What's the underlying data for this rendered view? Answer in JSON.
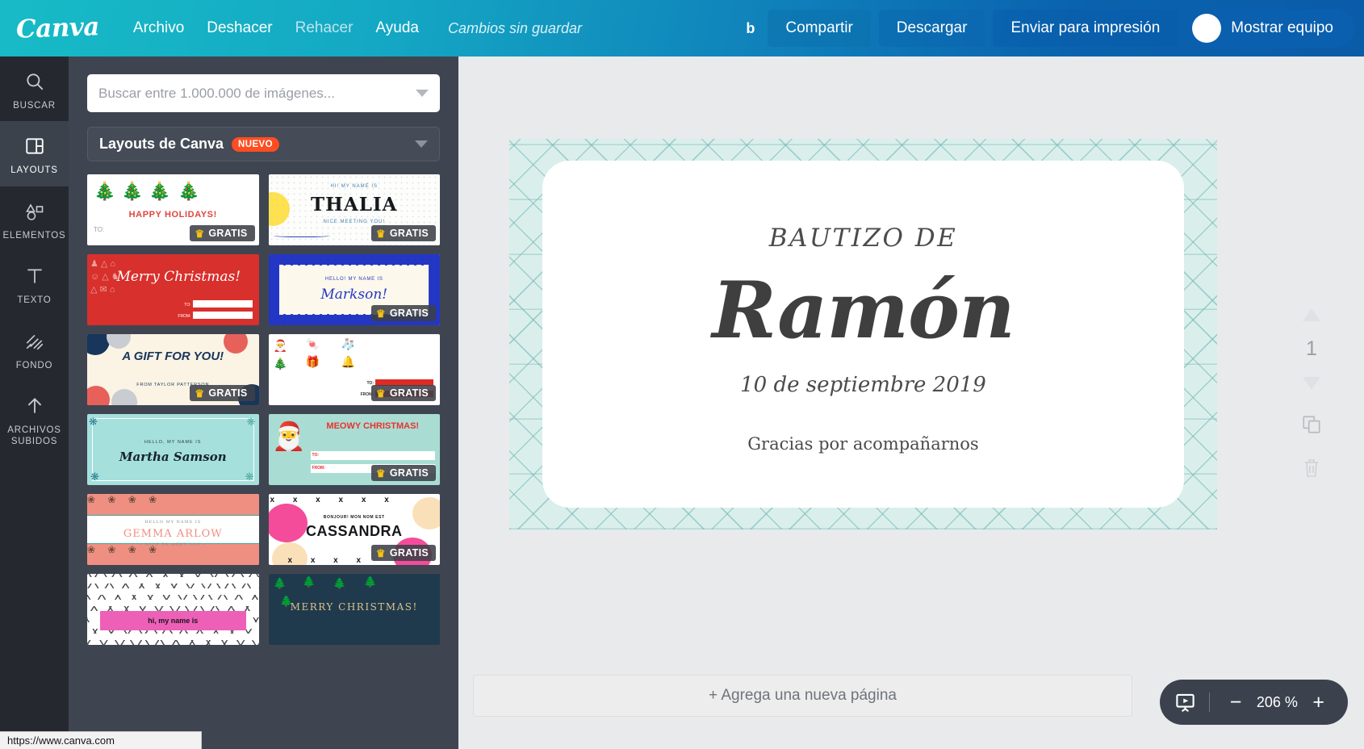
{
  "header": {
    "logo": "Canva",
    "menu": [
      {
        "label": "Archivo",
        "dim": false
      },
      {
        "label": "Deshacer",
        "dim": false
      },
      {
        "label": "Rehacer",
        "dim": true
      },
      {
        "label": "Ayuda",
        "dim": false
      }
    ],
    "save_status": "Cambios sin guardar",
    "b_mark": "b",
    "share_label": "Compartir",
    "download_label": "Descargar",
    "print_label": "Enviar para impresión",
    "team_label": "Mostrar equipo",
    "gradient_start": "#17bbc6",
    "gradient_end": "#0a5ba8"
  },
  "rail": {
    "items": [
      {
        "label": "BUSCAR",
        "icon": "search-icon",
        "active": false
      },
      {
        "label": "LAYOUTS",
        "icon": "layouts-icon",
        "active": true
      },
      {
        "label": "ELEMENTOS",
        "icon": "elements-icon",
        "active": false
      },
      {
        "label": "TEXTO",
        "icon": "text-icon",
        "active": false
      },
      {
        "label": "FONDO",
        "icon": "background-icon",
        "active": false
      },
      {
        "label": "ARCHIVOS SUBIDOS",
        "icon": "upload-icon",
        "active": false
      }
    ]
  },
  "panel": {
    "search_placeholder": "Buscar entre 1.000.000 de imágenes...",
    "search_value": "",
    "category_title": "Layouts de Canva",
    "category_badge": "NUEVO",
    "gratis_label": "GRATIS",
    "thumbnails": [
      {
        "id": "happy-holidays",
        "title": "HAPPY HOLIDAYS!",
        "sub": "TO:",
        "gratis": true
      },
      {
        "id": "thalia",
        "title": "THALIA",
        "sub": "HI! MY NAME IS",
        "sub2": "NICE MEETING YOU!",
        "gratis": true
      },
      {
        "id": "merry-christmas",
        "title": "Merry Christmas!",
        "sub": "TO:",
        "sub2": "FROM:",
        "gratis": false
      },
      {
        "id": "markson",
        "title": "Markson!",
        "sub": "HELLO! MY NAME IS",
        "gratis": true
      },
      {
        "id": "a-gift-for-you",
        "title": "A GIFT FOR YOU!",
        "sub": "FROM TAYLOR PATTERSON",
        "gratis": true
      },
      {
        "id": "xmas-icons",
        "title": "",
        "sub": "TO:",
        "sub2": "FROM:",
        "gratis": true
      },
      {
        "id": "martha-samson",
        "title": "Martha Samson",
        "sub": "HELLO, MY NAME IS",
        "gratis": false
      },
      {
        "id": "meowy-christmas",
        "title": "MEOWY CHRISTMAS!",
        "sub": "TO:",
        "sub2": "FROM:",
        "gratis": true
      },
      {
        "id": "gemma-arlow",
        "title": "GEMMA ARLOW",
        "sub": "HELLO MY NAME IS",
        "sub2": "• NICE TO MEET YOU •",
        "gratis": false
      },
      {
        "id": "cassandra",
        "title": "CASSANDRA",
        "sub": "BONJOUR! MON NOM EST",
        "gratis": true
      },
      {
        "id": "hi-my-name-is",
        "title": "hi, my name is",
        "sub": "",
        "gratis": false
      },
      {
        "id": "merry-christmas-trees",
        "title": "MERRY CHRISTMAS!",
        "sub": "",
        "gratis": false
      }
    ]
  },
  "document": {
    "title": "BAUTIZO DE",
    "name": "Ramón",
    "date": "10 de septiembre 2019",
    "thanks": "Gracias por acompañarnos",
    "border_color": "#daefeb",
    "pattern_color": "#6eb4b4"
  },
  "page_tools": {
    "up_icon": "triangle-up-icon",
    "page_number": "1",
    "down_icon": "triangle-down-icon",
    "duplicate_icon": "copy-icon",
    "delete_icon": "trash-icon"
  },
  "footer": {
    "add_page_label": "+ Agrega una nueva página",
    "present_icon": "present-icon",
    "zoom_out": "−",
    "zoom_value": "206 %",
    "zoom_in": "+"
  },
  "statusbar": {
    "url": "https://www.canva.com"
  }
}
